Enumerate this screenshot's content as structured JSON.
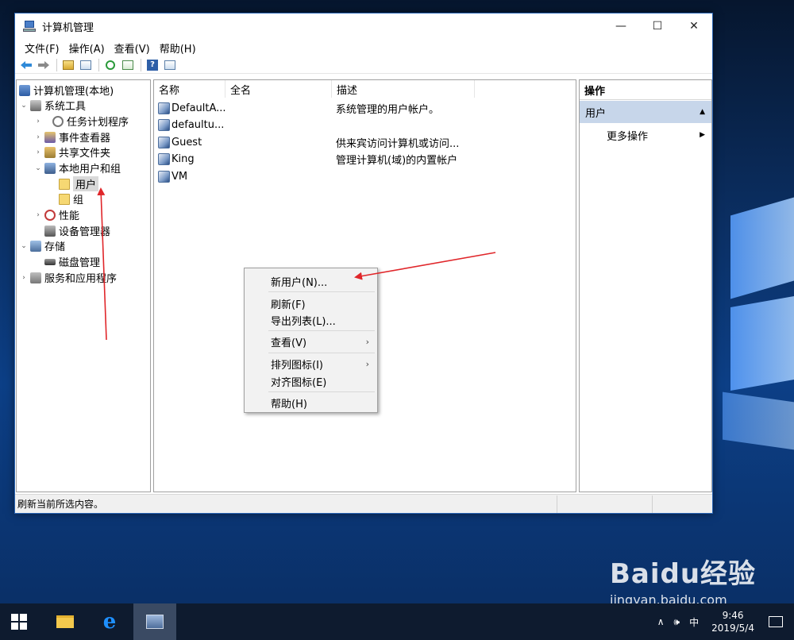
{
  "window": {
    "title": "计算机管理",
    "controls": {
      "minimize": "—",
      "maximize": "☐",
      "close": "✕"
    }
  },
  "menubar": [
    "文件(F)",
    "操作(A)",
    "查看(V)",
    "帮助(H)"
  ],
  "tree": {
    "root": "计算机管理(本地)",
    "system_tools": "系统工具",
    "task_scheduler": "任务计划程序",
    "event_viewer": "事件查看器",
    "shared_folders": "共享文件夹",
    "local_users": "本地用户和组",
    "users": "用户",
    "groups": "组",
    "performance": "性能",
    "device_manager": "设备管理器",
    "storage": "存储",
    "disk_management": "磁盘管理",
    "services_apps": "服务和应用程序"
  },
  "list": {
    "columns": [
      "名称",
      "全名",
      "描述"
    ],
    "rows": [
      {
        "name": "DefaultA...",
        "desc": "系统管理的用户帐户。"
      },
      {
        "name": "defaultu...",
        "desc": ""
      },
      {
        "name": "Guest",
        "desc": "供来宾访问计算机或访问..."
      },
      {
        "name": "King",
        "desc": "管理计算机(域)的内置帐户"
      },
      {
        "name": "VM",
        "desc": ""
      }
    ]
  },
  "actions": {
    "header": "操作",
    "section": "用户",
    "more": "更多操作"
  },
  "context_menu": {
    "new_user": "新用户(N)...",
    "refresh": "刷新(F)",
    "export": "导出列表(L)...",
    "view": "查看(V)",
    "arrange": "排列图标(I)",
    "align": "对齐图标(E)",
    "help": "帮助(H)"
  },
  "status": "刷新当前所选内容。",
  "taskbar": {
    "time": "9:46",
    "date": "2019/5/4",
    "ime": "中",
    "tray_caret": "∧"
  },
  "watermark": {
    "main": "Baidu经验",
    "sub": "jingyan.baidu.com"
  },
  "annotation_color": "#e0262a"
}
